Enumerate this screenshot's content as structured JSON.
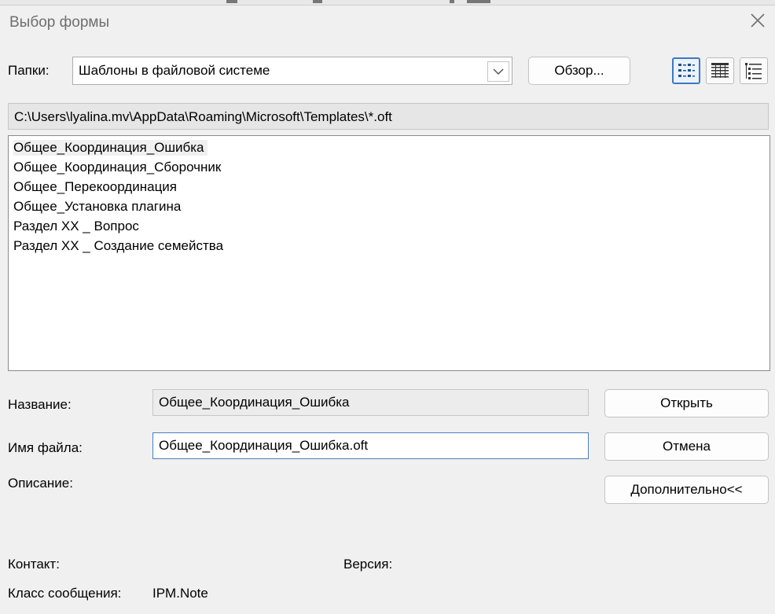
{
  "window": {
    "title": "Выбор формы"
  },
  "folders": {
    "label": "Папки:",
    "value": "Шаблоны в файловой системе",
    "browse_label": "Обзор..."
  },
  "view_buttons": [
    {
      "name": "icons-view",
      "active": true
    },
    {
      "name": "list-view",
      "active": false
    },
    {
      "name": "details-view",
      "active": false
    }
  ],
  "path": "C:\\Users\\lyalina.mv\\AppData\\Roaming\\Microsoft\\Templates\\*.oft",
  "forms": [
    "Общее_Координация_Ошибка",
    "Общее_Координация_Сборочник",
    "Общее_Перекоординация",
    "Общее_Установка плагина",
    "Раздел ХХ _ Вопрос",
    "Раздел ХХ _ Создание семейства"
  ],
  "selected_index": 0,
  "details": {
    "name_label": "Название:",
    "name_value": "Общее_Координация_Ошибка",
    "file_label": "Имя файла:",
    "file_value": "Общее_Координация_Ошибка.oft",
    "description_label": "Описание:",
    "contact_label": "Контакт:",
    "version_label": "Версия:",
    "class_label": "Класс сообщения:",
    "class_value": "IPM.Note"
  },
  "buttons": {
    "open": "Открыть",
    "cancel": "Отмена",
    "advanced": "Дополнительно<<"
  },
  "colors": {
    "accent": "#3a78c8",
    "background": "#f0f0f0"
  }
}
